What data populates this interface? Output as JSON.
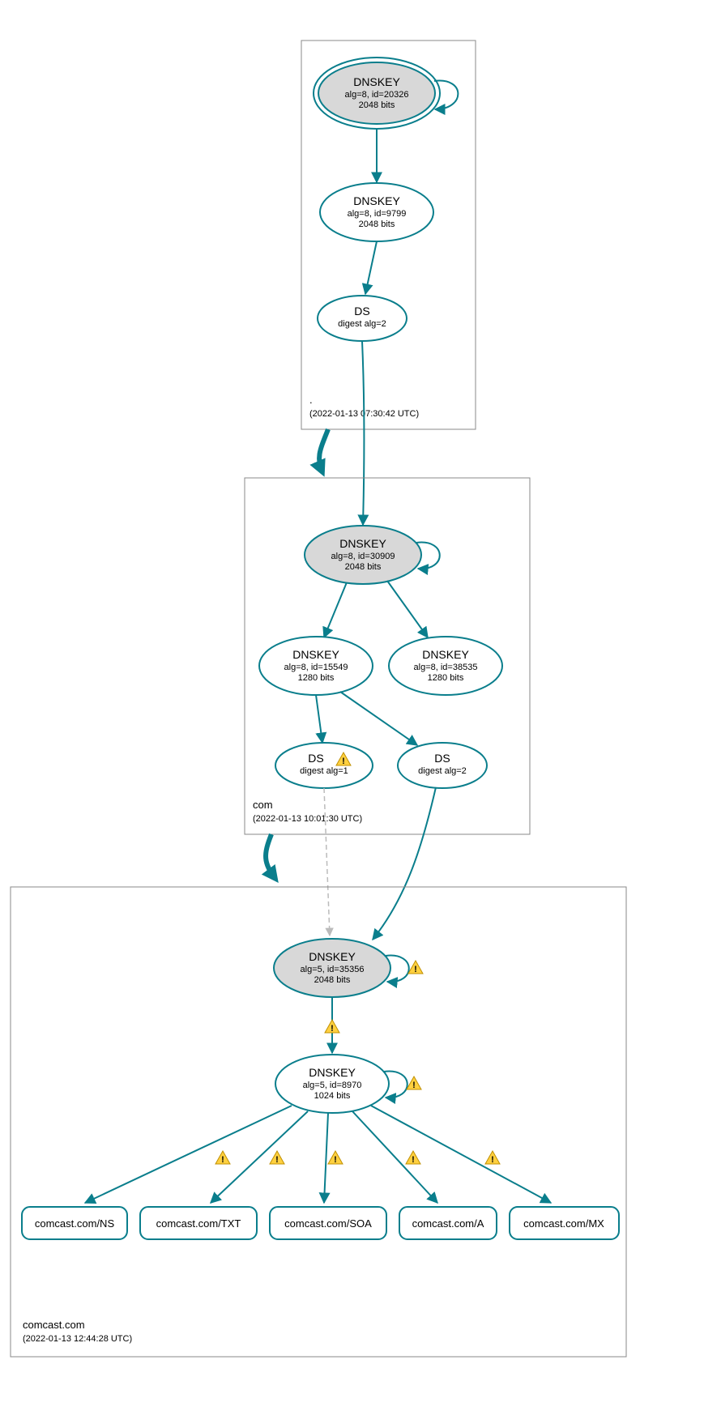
{
  "zones": {
    "root": {
      "name": ".",
      "timestamp": "(2022-01-13 07:30:42 UTC)"
    },
    "com": {
      "name": "com",
      "timestamp": "(2022-01-13 10:01:30 UTC)"
    },
    "domain": {
      "name": "comcast.com",
      "timestamp": "(2022-01-13 12:44:28 UTC)"
    }
  },
  "nodes": {
    "root_ksk": {
      "title": "DNSKEY",
      "sub1": "alg=8, id=20326",
      "sub2": "2048 bits"
    },
    "root_zsk": {
      "title": "DNSKEY",
      "sub1": "alg=8, id=9799",
      "sub2": "2048 bits"
    },
    "root_ds": {
      "title": "DS",
      "sub1": "digest alg=2"
    },
    "com_ksk": {
      "title": "DNSKEY",
      "sub1": "alg=8, id=30909",
      "sub2": "2048 bits"
    },
    "com_zsk1": {
      "title": "DNSKEY",
      "sub1": "alg=8, id=15549",
      "sub2": "1280 bits"
    },
    "com_zsk2": {
      "title": "DNSKEY",
      "sub1": "alg=8, id=38535",
      "sub2": "1280 bits"
    },
    "com_ds1": {
      "title": "DS",
      "sub1": "digest alg=1"
    },
    "com_ds2": {
      "title": "DS",
      "sub1": "digest alg=2"
    },
    "dom_ksk": {
      "title": "DNSKEY",
      "sub1": "alg=5, id=35356",
      "sub2": "2048 bits"
    },
    "dom_zsk": {
      "title": "DNSKEY",
      "sub1": "alg=5, id=8970",
      "sub2": "1024 bits"
    }
  },
  "rrsets": {
    "ns": "comcast.com/NS",
    "txt": "comcast.com/TXT",
    "soa": "comcast.com/SOA",
    "a": "comcast.com/A",
    "mx": "comcast.com/MX"
  },
  "colors": {
    "stroke": "#0a7e8c",
    "grey": "#d8d8d8",
    "warn_fill": "#ffd040"
  }
}
